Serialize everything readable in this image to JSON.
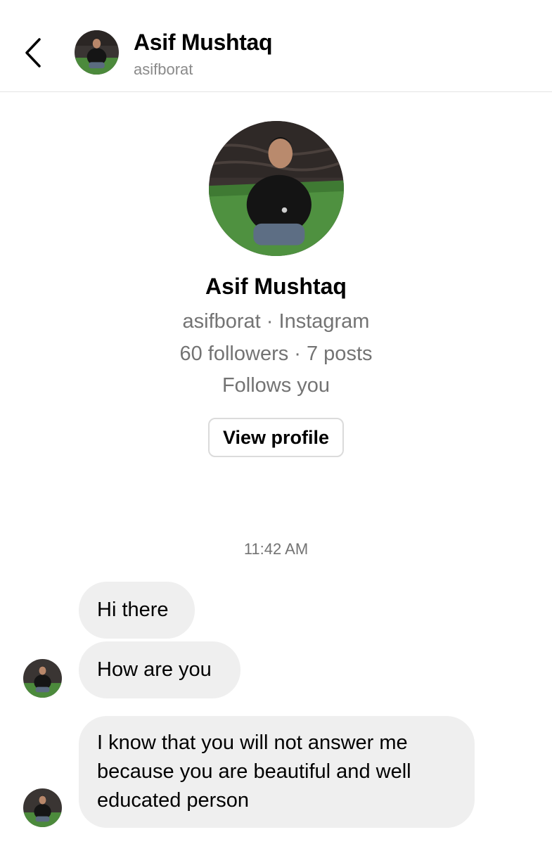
{
  "header": {
    "name": "Asif Mushtaq",
    "handle": "asifborat",
    "back_icon": "chevron-left-icon"
  },
  "profile": {
    "name": "Asif Mushtaq",
    "handle_platform": "asifborat · Instagram",
    "stats": "60 followers · 7 posts",
    "relation": "Follows you",
    "view_profile_label": "View profile"
  },
  "chat": {
    "timestamp": "11:42 AM",
    "messages": [
      {
        "text": "Hi there"
      },
      {
        "text": "How are you"
      },
      {
        "text": "I know that you will not answer me because you are beautiful and well educated person"
      }
    ]
  },
  "colors": {
    "bubble": "#efefef",
    "secondary_text": "#737373",
    "divider": "#e3e3e3"
  }
}
